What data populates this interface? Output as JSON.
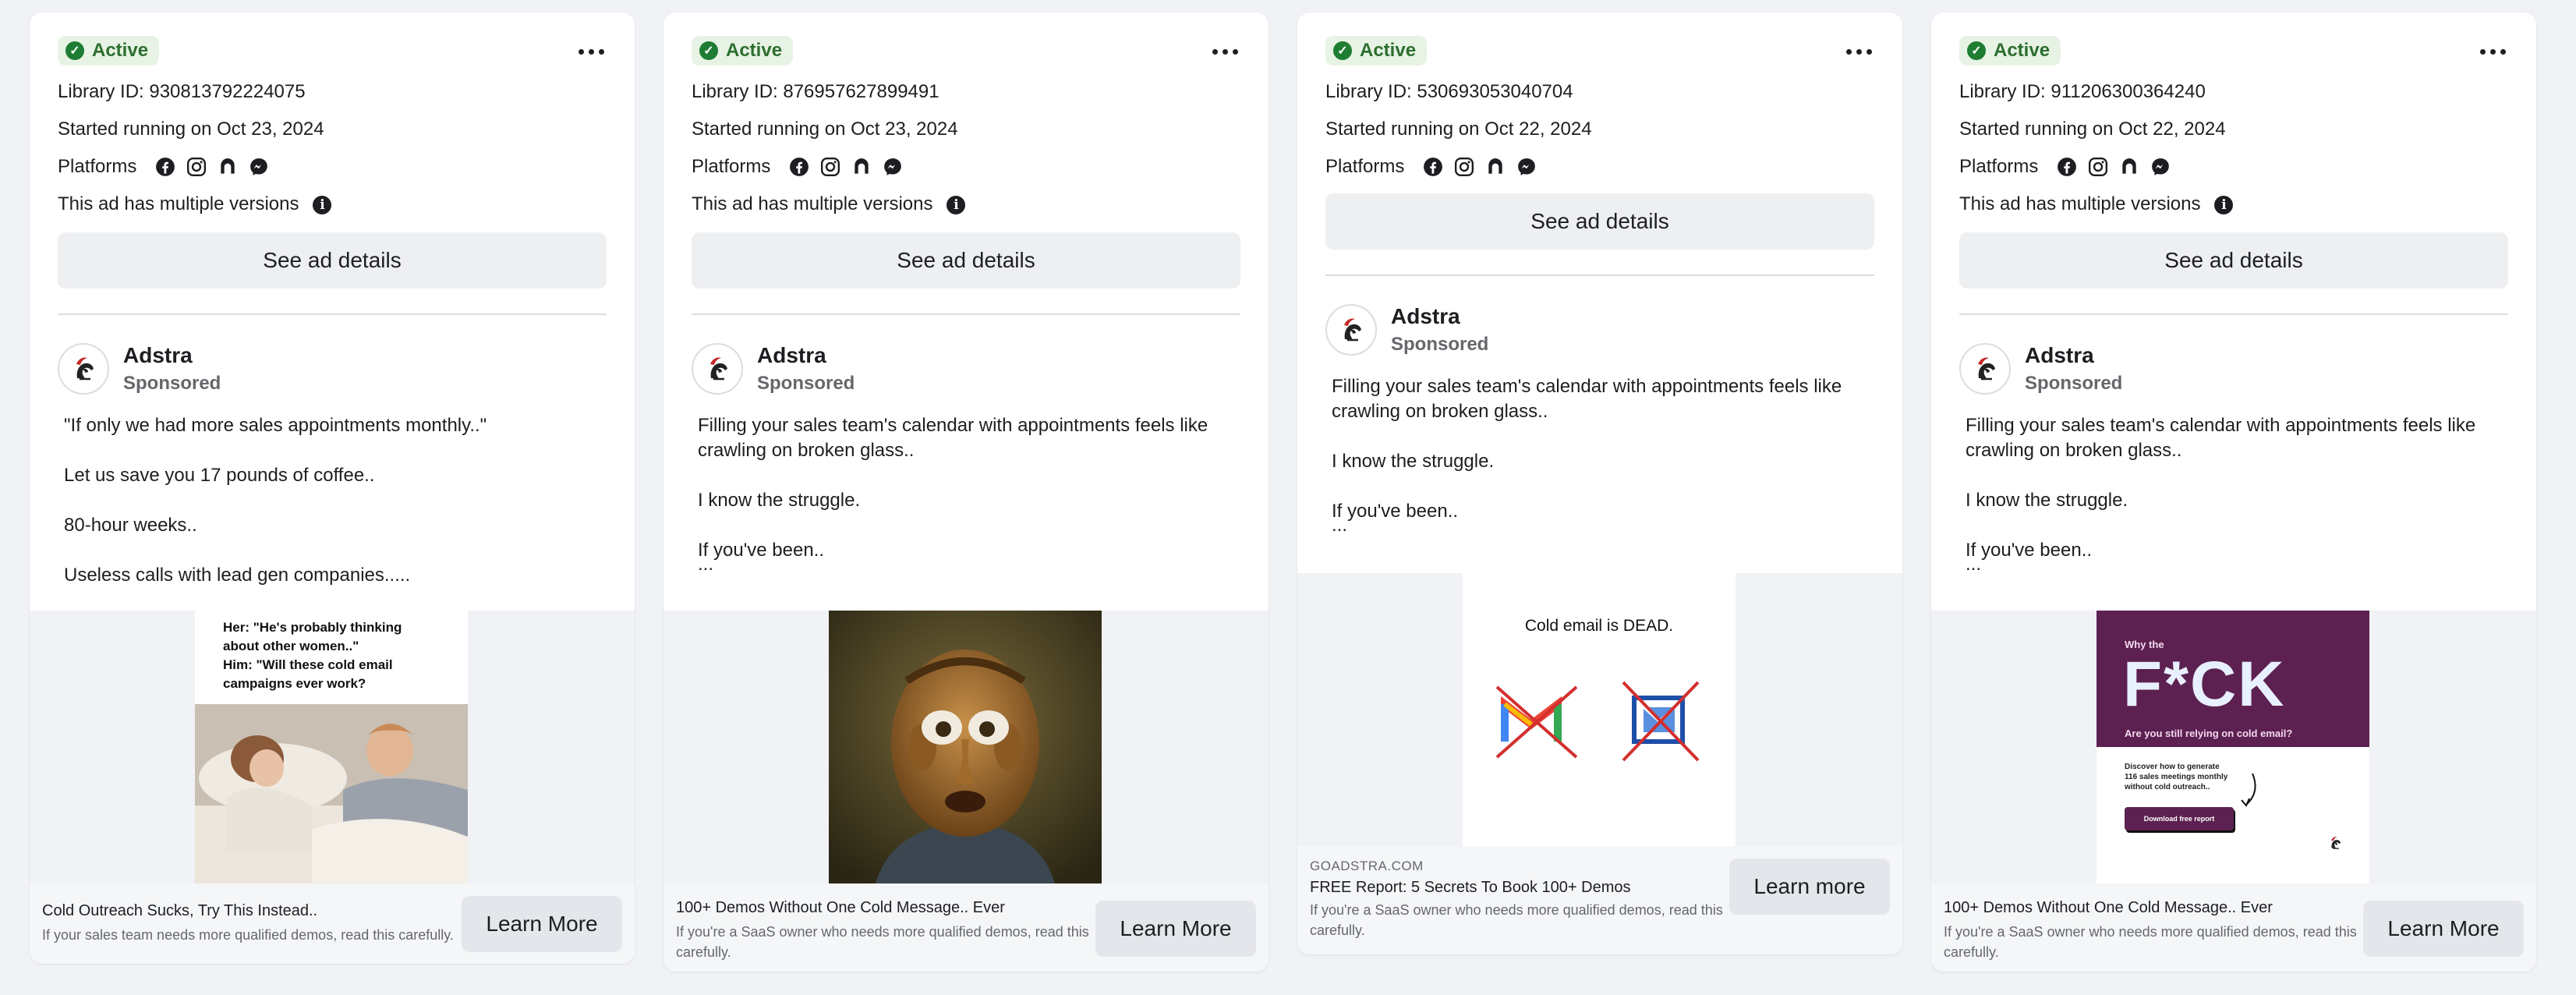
{
  "cards": [
    {
      "status": "Active",
      "library_id": "Library ID: 930813792224075",
      "started": "Started running on Oct 23, 2024",
      "platforms_label": "Platforms",
      "versions_note": "This ad has multiple versions",
      "details_label": "See ad details",
      "advertiser": "Adstra",
      "sponsored": "Sponsored",
      "body": [
        "\"If only we had more sales appointments monthly..\"",
        "Let us save you 17 pounds of coffee..",
        "80-hour weeks..",
        "Useless calls with lead gen companies....."
      ],
      "creative": {
        "lines": [
          "Her: \"He's probably thinking",
          "about other women..\"",
          "Him: \"Will these cold email",
          "campaigns ever work?"
        ]
      },
      "footer": {
        "domain": "",
        "title": "Cold Outreach Sucks, Try This Instead..",
        "desc": "If your sales team needs more qualified demos, read this carefully.",
        "cta": "Learn More"
      }
    },
    {
      "status": "Active",
      "library_id": "Library ID: 876957627899491",
      "started": "Started running on Oct 23, 2024",
      "platforms_label": "Platforms",
      "versions_note": "This ad has multiple versions",
      "details_label": "See ad details",
      "advertiser": "Adstra",
      "sponsored": "Sponsored",
      "body": [
        "Filling your sales team's calendar with appointments feels like crawling on broken glass..",
        "I know the struggle.",
        "If you've been.."
      ],
      "ellipsis": "...",
      "footer": {
        "domain": "",
        "title": "100+ Demos Without One Cold Message.. Ever",
        "desc": "If you're a SaaS owner who needs more qualified demos, read this carefully.",
        "cta": "Learn More"
      }
    },
    {
      "status": "Active",
      "library_id": "Library ID: 530693053040704",
      "started": "Started running on Oct 22, 2024",
      "platforms_label": "Platforms",
      "details_label": "See ad details",
      "advertiser": "Adstra",
      "sponsored": "Sponsored",
      "body": [
        "Filling your sales team's calendar with appointments feels like crawling on broken glass..",
        "I know the struggle.",
        "If you've been.."
      ],
      "ellipsis": "...",
      "creative": {
        "headline": "Cold email is DEAD."
      },
      "footer": {
        "domain": "GOADSTRA.COM",
        "title": "FREE Report: 5 Secrets To Book 100+ Demos",
        "desc": "If you're a SaaS owner who needs more qualified demos, read this carefully.",
        "cta": "Learn more"
      }
    },
    {
      "status": "Active",
      "library_id": "Library ID: 911206300364240",
      "started": "Started running on Oct 22, 2024",
      "platforms_label": "Platforms",
      "versions_note": "This ad has multiple versions",
      "details_label": "See ad details",
      "advertiser": "Adstra",
      "sponsored": "Sponsored",
      "body": [
        "Filling your sales team's calendar with appointments feels like crawling on broken glass..",
        "I know the struggle.",
        "If you've been.."
      ],
      "ellipsis": "...",
      "creative": {
        "small_top": "Why the",
        "big": "F*CK",
        "question": "Are you still relying on cold email?",
        "sub": [
          "Discover how to generate",
          "116 sales meetings monthly",
          "without cold outreach.."
        ],
        "button": "Download free report"
      },
      "footer": {
        "domain": "",
        "title": "100+ Demos Without One Cold Message.. Ever",
        "desc": "If you're a SaaS owner who needs more qualified demos, read this carefully.",
        "cta": "Learn More"
      }
    }
  ],
  "platform_icons": [
    "facebook-icon",
    "instagram-icon",
    "audience-network-icon",
    "messenger-icon"
  ],
  "colors": {
    "active_green": "#1e7d32",
    "badge_bg": "#e7f3e4",
    "creative_purple": "#5c2150"
  }
}
